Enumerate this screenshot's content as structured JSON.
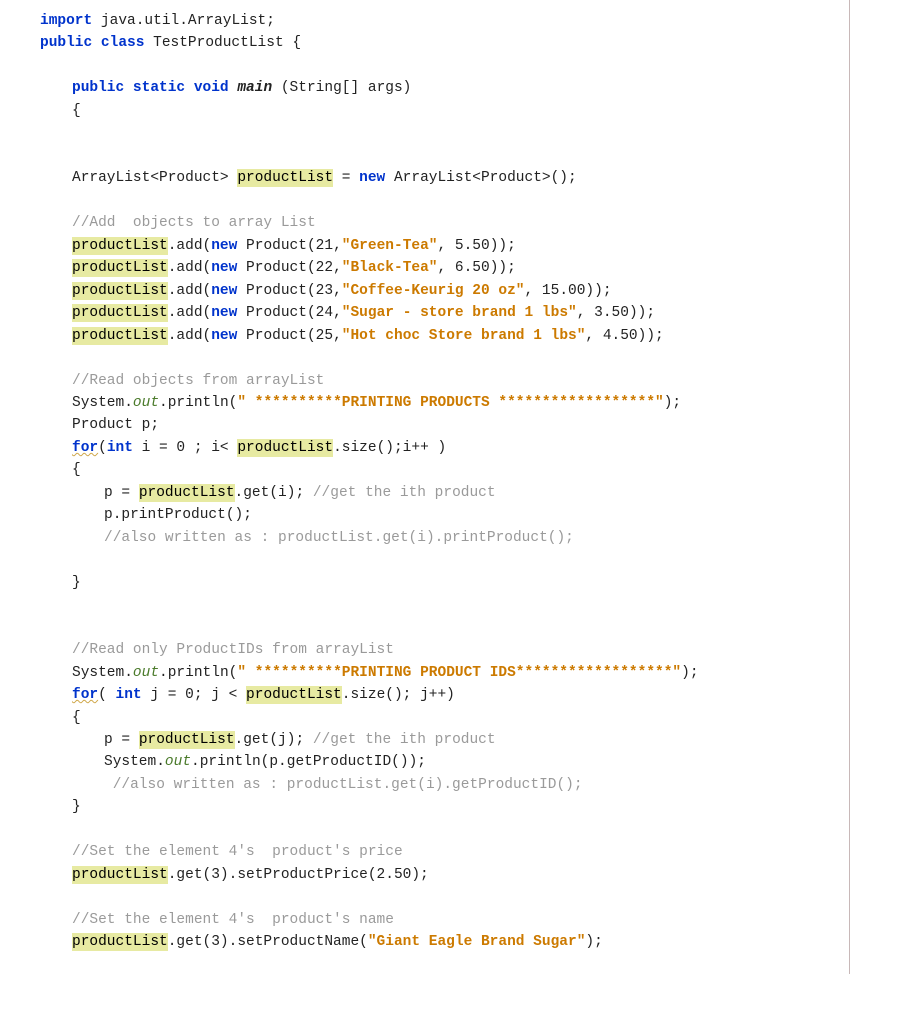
{
  "lines": {
    "l1_import": "import",
    "l1_pkg": " java.util.ArrayList;",
    "l2_public": "public class",
    "l2_name": " TestProductList {",
    "l4_sig": "public static void",
    "l4_main": " main",
    "l4_args": " (String[] args)",
    "l5_brace": "{",
    "l8a": "ArrayList<Product> ",
    "l8_hl": "productList",
    "l8b": " = ",
    "l8_new": "new",
    "l8c": " ArrayList<Product>();",
    "c_add": "//Add  objects to array List",
    "add1_hl": "productList",
    "add_mid": ".add(",
    "add_new": "new",
    "add_prod": " Product(",
    "add1_id": "21,",
    "add1_str": "\"Green-Tea\"",
    "add1_rest": ", 5.50));",
    "add2_id": "22,",
    "add2_str": "\"Black-Tea\"",
    "add2_rest": ", 6.50));",
    "add3_id": "23,",
    "add3_str": "\"Coffee-Keurig 20 oz\"",
    "add3_rest": ", 15.00));",
    "add4_id": "24,",
    "add4_str": "\"Sugar - store brand 1 lbs\"",
    "add4_rest": ", 3.50));",
    "add5_id": "25,",
    "add5_str": "\"Hot choc Store brand 1 lbs\"",
    "add5_rest": ", 4.50));",
    "c_read": "//Read objects from arrayList",
    "sys": "System.",
    "out": "out",
    "println": ".println(",
    "str_print1": "\" **********PRINTING PRODUCTS ******************\"",
    "close_paren": ");",
    "prod_p": "Product p;",
    "for_kw": "for",
    "for1_cond_a": "(",
    "int_kw": "int",
    "for1_cond_b": " i = 0 ; i< ",
    "for1_cond_c": ".size();i++ )",
    "brace_open": "{",
    "for1_body_a": "p = ",
    "for1_body_b": ".get(i); ",
    "for1_body_c": "//get the ith product",
    "for1_body2": "p.printProduct();",
    "for1_body3": "//also written as : productList.get(i).printProduct();",
    "brace_close": "}",
    "c_read2": "//Read only ProductIDs from arrayList",
    "str_print2": "\" **********PRINTING PRODUCT IDS******************\"",
    "for2_cond_a": "( ",
    "for2_cond_b": " j = 0; j < ",
    "for2_cond_c": ".size(); j++)",
    "for2_body_a": "p = ",
    "for2_body_b": ".get(j); ",
    "for2_body_c": "//get the ith product",
    "for2_body2a": "System.",
    "for2_body2b": ".println(p.getProductID());",
    "for2_body3": " //also written as : productList.get(i).getProductID();",
    "c_set1": "//Set the element 4's  product's price",
    "set1_hl": "productList",
    "set1_rest": ".get(3).setProductPrice(2.50);",
    "c_set2": "//Set the element 4's  product's name",
    "set2_rest": ".get(3).setProductName(",
    "set2_str": "\"Giant Eagle Brand Sugar\"",
    "set2_end": ");"
  }
}
